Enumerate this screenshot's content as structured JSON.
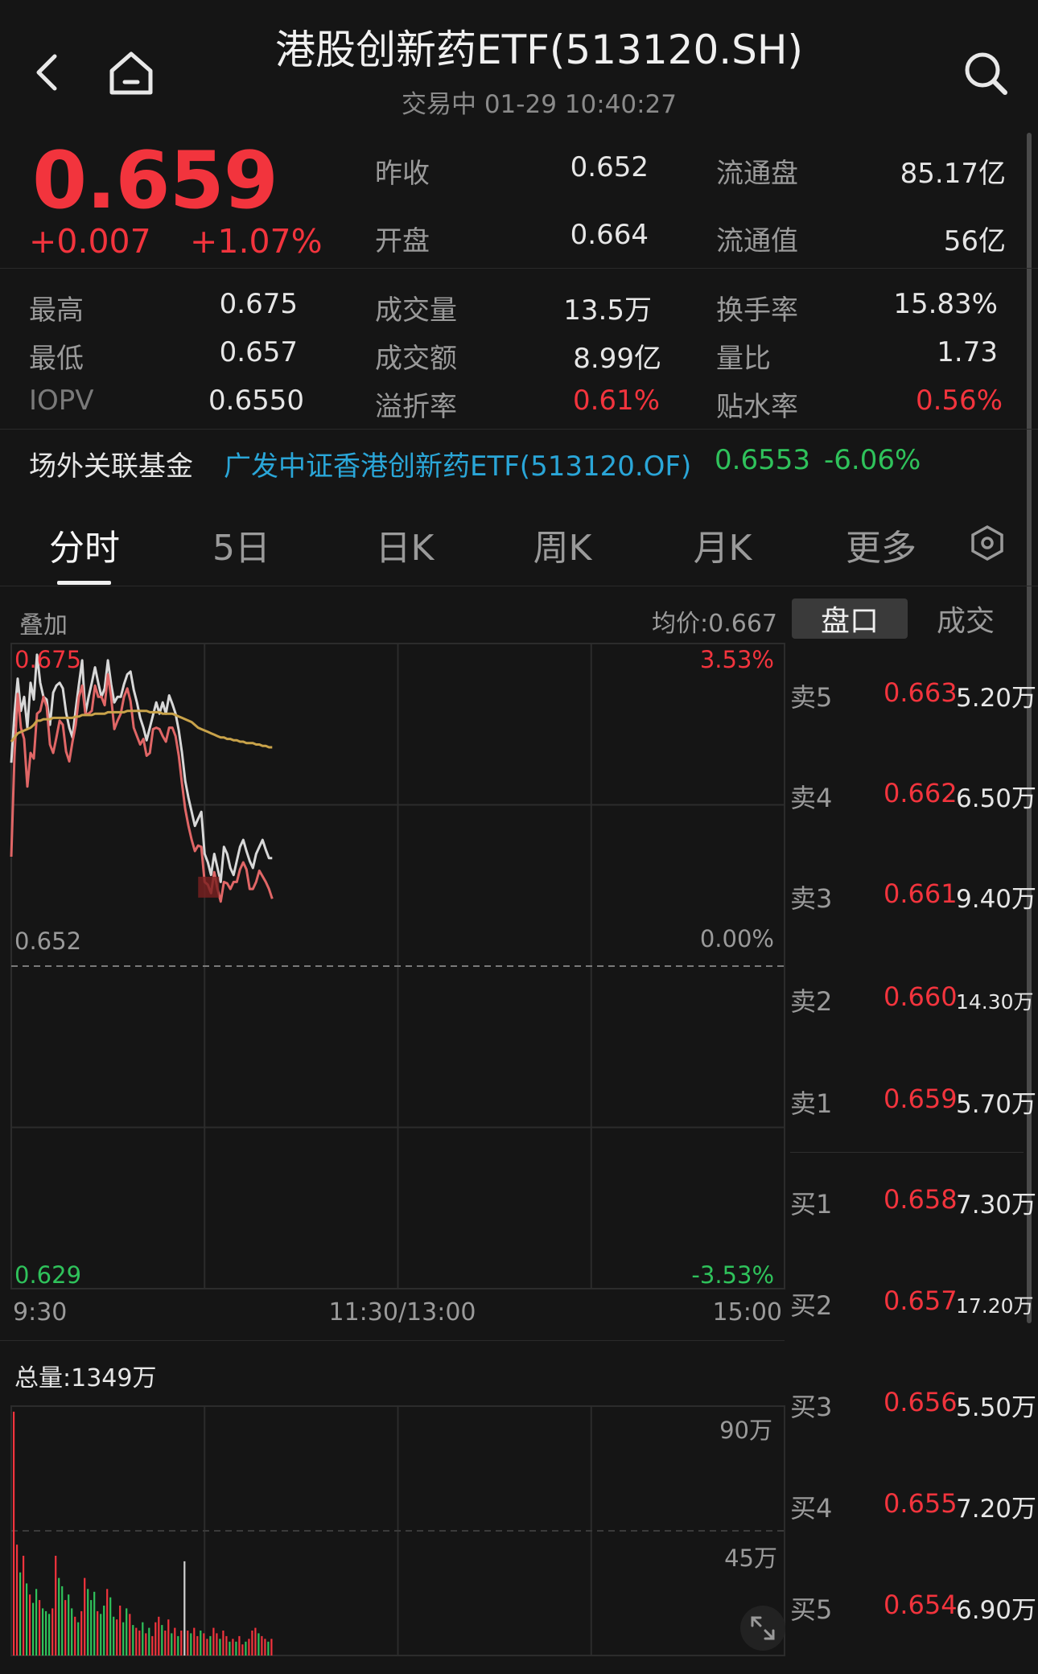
{
  "header": {
    "title": "港股创新药ETF(513120.SH)",
    "subtitle": "交易中 01-29 10:40:27"
  },
  "quote": {
    "price": "0.659",
    "change": "+0.007",
    "change_pct": "+1.07%",
    "fields": [
      {
        "label": "昨收",
        "value": "0.652"
      },
      {
        "label": "流通盘",
        "value": "85.17亿"
      },
      {
        "label": "开盘",
        "value": "0.664"
      },
      {
        "label": "流通值",
        "value": "56亿"
      },
      {
        "label": "最高",
        "value": "0.675"
      },
      {
        "label": "成交量",
        "value": "13.5万"
      },
      {
        "label": "换手率",
        "value": "15.83%"
      },
      {
        "label": "最低",
        "value": "0.657"
      },
      {
        "label": "成交额",
        "value": "8.99亿"
      },
      {
        "label": "量比",
        "value": "1.73"
      },
      {
        "label": "IOPV",
        "value": "0.6550"
      },
      {
        "label": "溢折率",
        "value": "0.61%"
      },
      {
        "label": "贴水率",
        "value": "0.56%"
      }
    ]
  },
  "linked_fund": {
    "label": "场外关联基金",
    "name": "广发中证香港创新药ETF(513120.OF)",
    "nav": "0.6553",
    "pct": "-6.06%"
  },
  "tabs": [
    "分时",
    "5日",
    "日K",
    "周K",
    "月K",
    "更多"
  ],
  "chart_header": {
    "overlay": "叠加",
    "avg": "均价:0.667"
  },
  "book_tabs": [
    "盘口",
    "成交"
  ],
  "chart_data": {
    "type": "line",
    "title": "",
    "y_labels": {
      "top": "0.675",
      "mid": "0.652",
      "bottom": "0.629"
    },
    "pct_labels": {
      "top": "3.53%",
      "mid": "0.00%",
      "bottom": "-3.53%"
    },
    "x_labels": [
      "9:30",
      "11:30/13:00",
      "15:00"
    ],
    "ylim": [
      0.629,
      0.675
    ],
    "prev_close": 0.652,
    "session_minutes": 240,
    "series": [
      {
        "color": "#d8d8d8",
        "values": [
          0.6665,
          0.67,
          0.6725,
          0.6702,
          0.6712,
          0.669,
          0.6722,
          0.671,
          0.6742,
          0.6722,
          0.6712,
          0.671,
          0.6692,
          0.6715,
          0.672,
          0.6722,
          0.6718,
          0.6701,
          0.669,
          0.6683,
          0.6703,
          0.6721,
          0.6738,
          0.67,
          0.6712,
          0.6722,
          0.6733,
          0.6722,
          0.6712,
          0.6718,
          0.6738,
          0.6721,
          0.6708,
          0.6712,
          0.6712,
          0.6721,
          0.6728,
          0.673,
          0.6717,
          0.6708,
          0.6697,
          0.669,
          0.6681,
          0.669,
          0.6699,
          0.6708,
          0.67,
          0.6708,
          0.67,
          0.6713,
          0.6707,
          0.67,
          0.6688,
          0.6672,
          0.6652,
          0.664,
          0.663,
          0.662,
          0.6625,
          0.663,
          0.66,
          0.6594,
          0.6585,
          0.66,
          0.659,
          0.658,
          0.6605,
          0.66,
          0.659,
          0.6585,
          0.6595,
          0.6605,
          0.661,
          0.6602,
          0.6595,
          0.659,
          0.66,
          0.6605,
          0.661,
          0.6603,
          0.6597,
          0.6597
        ]
      },
      {
        "color": "#e06666",
        "values": [
          0.6598,
          0.667,
          0.6714,
          0.669,
          0.6682,
          0.6648,
          0.6672,
          0.6668,
          0.67,
          0.6702,
          0.6712,
          0.6705,
          0.6678,
          0.6672,
          0.6683,
          0.6695,
          0.6692,
          0.6673,
          0.6666,
          0.668,
          0.6692,
          0.6712,
          0.672,
          0.67,
          0.67,
          0.6702,
          0.672,
          0.6712,
          0.6712,
          0.6706,
          0.6728,
          0.6712,
          0.6689,
          0.6695,
          0.67,
          0.6712,
          0.6718,
          0.6709,
          0.669,
          0.6684,
          0.6678,
          0.6682,
          0.667,
          0.6672,
          0.6689,
          0.669,
          0.6689,
          0.6684,
          0.668,
          0.669,
          0.669,
          0.6684,
          0.667,
          0.665,
          0.6632,
          0.662,
          0.661,
          0.6602,
          0.6606,
          0.6605,
          0.658,
          0.6578,
          0.6572,
          0.6587,
          0.6575,
          0.6566,
          0.658,
          0.6579,
          0.6575,
          0.658,
          0.658,
          0.6589,
          0.6594,
          0.6589,
          0.6575,
          0.6575,
          0.658,
          0.6588,
          0.6584,
          0.658,
          0.6575,
          0.6568
        ]
      },
      {
        "color": "#c9a34a",
        "values": [
          0.668,
          0.6683,
          0.6686,
          0.6687,
          0.6688,
          0.6689,
          0.669,
          0.6692,
          0.6695,
          0.6695,
          0.6696,
          0.6696,
          0.6696,
          0.6697,
          0.6697,
          0.6697,
          0.6697,
          0.6697,
          0.6697,
          0.6697,
          0.6698,
          0.6698,
          0.6699,
          0.6699,
          0.6699,
          0.6699,
          0.67,
          0.67,
          0.67,
          0.67,
          0.6701,
          0.6701,
          0.6701,
          0.6701,
          0.6701,
          0.6701,
          0.6702,
          0.6702,
          0.6702,
          0.6702,
          0.6702,
          0.6702,
          0.6702,
          0.6701,
          0.6701,
          0.6701,
          0.6701,
          0.67,
          0.67,
          0.67,
          0.67,
          0.6699,
          0.6698,
          0.6697,
          0.6696,
          0.6695,
          0.6694,
          0.6692,
          0.669,
          0.6689,
          0.6688,
          0.6687,
          0.6686,
          0.6685,
          0.6684,
          0.6683,
          0.6683,
          0.6682,
          0.6682,
          0.6681,
          0.6681,
          0.668,
          0.668,
          0.6679,
          0.6679,
          0.6679,
          0.6678,
          0.6678,
          0.6677,
          0.6677,
          0.6676,
          0.6676
        ]
      }
    ]
  },
  "volume": {
    "total_label": "总量:1349万",
    "labels": [
      "90万",
      "45万"
    ],
    "ymax": 90,
    "bars": [
      {
        "v": 88,
        "c": "r"
      },
      {
        "v": 40,
        "c": "r"
      },
      {
        "v": 30,
        "c": "g"
      },
      {
        "v": 36,
        "c": "r"
      },
      {
        "v": 26,
        "c": "g"
      },
      {
        "v": 22,
        "c": "r"
      },
      {
        "v": 19,
        "c": "g"
      },
      {
        "v": 24,
        "c": "g"
      },
      {
        "v": 20,
        "c": "r"
      },
      {
        "v": 17,
        "c": "g"
      },
      {
        "v": 16,
        "c": "g"
      },
      {
        "v": 15,
        "c": "g"
      },
      {
        "v": 17,
        "c": "r"
      },
      {
        "v": 36,
        "c": "r"
      },
      {
        "v": 28,
        "c": "g"
      },
      {
        "v": 25,
        "c": "g"
      },
      {
        "v": 20,
        "c": "r"
      },
      {
        "v": 22,
        "c": "g"
      },
      {
        "v": 17,
        "c": "g"
      },
      {
        "v": 14,
        "c": "r"
      },
      {
        "v": 12,
        "c": "g"
      },
      {
        "v": 16,
        "c": "r"
      },
      {
        "v": 28,
        "c": "r"
      },
      {
        "v": 24,
        "c": "g"
      },
      {
        "v": 20,
        "c": "g"
      },
      {
        "v": 23,
        "c": "g"
      },
      {
        "v": 16,
        "c": "r"
      },
      {
        "v": 15,
        "c": "g"
      },
      {
        "v": 18,
        "c": "g"
      },
      {
        "v": 24,
        "c": "r"
      },
      {
        "v": 21,
        "c": "g"
      },
      {
        "v": 14,
        "c": "g"
      },
      {
        "v": 13,
        "c": "r"
      },
      {
        "v": 18,
        "c": "r"
      },
      {
        "v": 12,
        "c": "g"
      },
      {
        "v": 17,
        "c": "g"
      },
      {
        "v": 15,
        "c": "r"
      },
      {
        "v": 11,
        "c": "g"
      },
      {
        "v": 10,
        "c": "r"
      },
      {
        "v": 9,
        "c": "r"
      },
      {
        "v": 12,
        "c": "g"
      },
      {
        "v": 8,
        "c": "r"
      },
      {
        "v": 10,
        "c": "g"
      },
      {
        "v": 7,
        "c": "r"
      },
      {
        "v": 12,
        "c": "r"
      },
      {
        "v": 14,
        "c": "r"
      },
      {
        "v": 11,
        "c": "g"
      },
      {
        "v": 9,
        "c": "r"
      },
      {
        "v": 13,
        "c": "r"
      },
      {
        "v": 8,
        "c": "g"
      },
      {
        "v": 10,
        "c": "r"
      },
      {
        "v": 7,
        "c": "g"
      },
      {
        "v": 9,
        "c": "r"
      },
      {
        "v": 34,
        "c": "w"
      },
      {
        "v": 9,
        "c": "r"
      },
      {
        "v": 8,
        "c": "g"
      },
      {
        "v": 10,
        "c": "r"
      },
      {
        "v": 7,
        "c": "r"
      },
      {
        "v": 9,
        "c": "g"
      },
      {
        "v": 8,
        "c": "r"
      },
      {
        "v": 6,
        "c": "r"
      },
      {
        "v": 7,
        "c": "g"
      },
      {
        "v": 10,
        "c": "r"
      },
      {
        "v": 8,
        "c": "r"
      },
      {
        "v": 6,
        "c": "g"
      },
      {
        "v": 9,
        "c": "r"
      },
      {
        "v": 7,
        "c": "r"
      },
      {
        "v": 5,
        "c": "g"
      },
      {
        "v": 6,
        "c": "r"
      },
      {
        "v": 5,
        "c": "g"
      },
      {
        "v": 7,
        "c": "r"
      },
      {
        "v": 4,
        "c": "r"
      },
      {
        "v": 5,
        "c": "g"
      },
      {
        "v": 6,
        "c": "r"
      },
      {
        "v": 9,
        "c": "r"
      },
      {
        "v": 10,
        "c": "r"
      },
      {
        "v": 8,
        "c": "g"
      },
      {
        "v": 7,
        "c": "r"
      },
      {
        "v": 6,
        "c": "r"
      },
      {
        "v": 5,
        "c": "g"
      },
      {
        "v": 6,
        "c": "r"
      }
    ]
  },
  "order_book": {
    "asks": [
      {
        "label": "卖5",
        "price": "0.663",
        "vol": "5.20万"
      },
      {
        "label": "卖4",
        "price": "0.662",
        "vol": "6.50万"
      },
      {
        "label": "卖3",
        "price": "0.661",
        "vol": "9.40万"
      },
      {
        "label": "卖2",
        "price": "0.660",
        "vol": "14.30万"
      },
      {
        "label": "卖1",
        "price": "0.659",
        "vol": "5.70万"
      }
    ],
    "bids": [
      {
        "label": "买1",
        "price": "0.658",
        "vol": "7.30万"
      },
      {
        "label": "买2",
        "price": "0.657",
        "vol": "17.20万"
      },
      {
        "label": "买3",
        "price": "0.656",
        "vol": "5.50万"
      },
      {
        "label": "买4",
        "price": "0.655",
        "vol": "7.20万"
      },
      {
        "label": "买5",
        "price": "0.654",
        "vol": "6.90万"
      }
    ]
  },
  "colors": {
    "up": "#f2343d",
    "down": "#2fc25b",
    "accent": "#2aa6d8",
    "bg": "#151515"
  }
}
